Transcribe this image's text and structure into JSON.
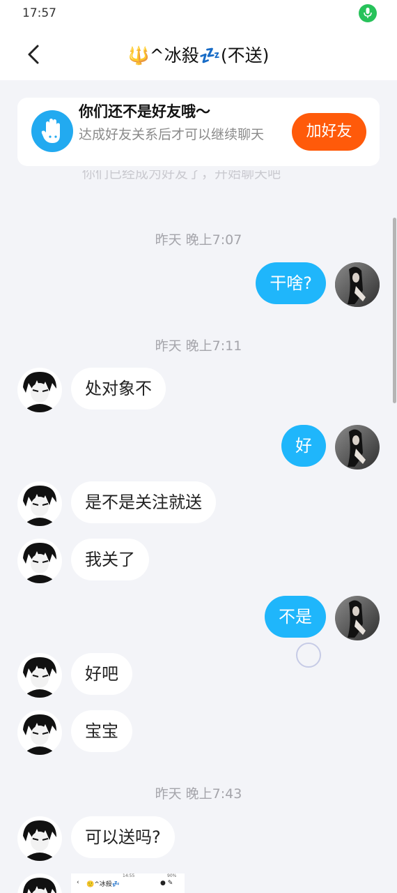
{
  "status_bar": {
    "time": "17:57",
    "mic_icon": "microphone-icon",
    "mic_color": "#27c25a"
  },
  "nav": {
    "title": "🔱^冰殺💤(不送)",
    "back_icon": "chevron-left-icon"
  },
  "banner": {
    "title": "你们还不是好友哦～",
    "subtitle": "达成好友关系后才可以继续聊天",
    "button_label": "加好友",
    "button_color": "#ff5a0a",
    "icon": "waving-hand-icon"
  },
  "ghost_text": "你们已经成为好友了，开始聊天吧",
  "timestamps": [
    "昨天 晚上7:07",
    "昨天 晚上7:11",
    "昨天 晚上7:43"
  ],
  "messages": [
    {
      "side": "out",
      "text": "干啥?"
    },
    {
      "side": "in",
      "text": "处对象不"
    },
    {
      "side": "out",
      "text": "好"
    },
    {
      "side": "in",
      "text": "是不是关注就送"
    },
    {
      "side": "in",
      "text": "我关了"
    },
    {
      "side": "out",
      "text": "不是"
    },
    {
      "side": "in",
      "text": "好吧"
    },
    {
      "side": "in",
      "text": "宝宝"
    },
    {
      "side": "in",
      "text": "可以送吗?"
    }
  ],
  "image_message": {
    "status_time": "14:55",
    "battery": "90%",
    "title": "🙂^冰殺💤"
  },
  "colors": {
    "outgoing_bubble": "#1fb6fb",
    "incoming_bubble": "#ffffff",
    "background": "#f3f4f8"
  }
}
